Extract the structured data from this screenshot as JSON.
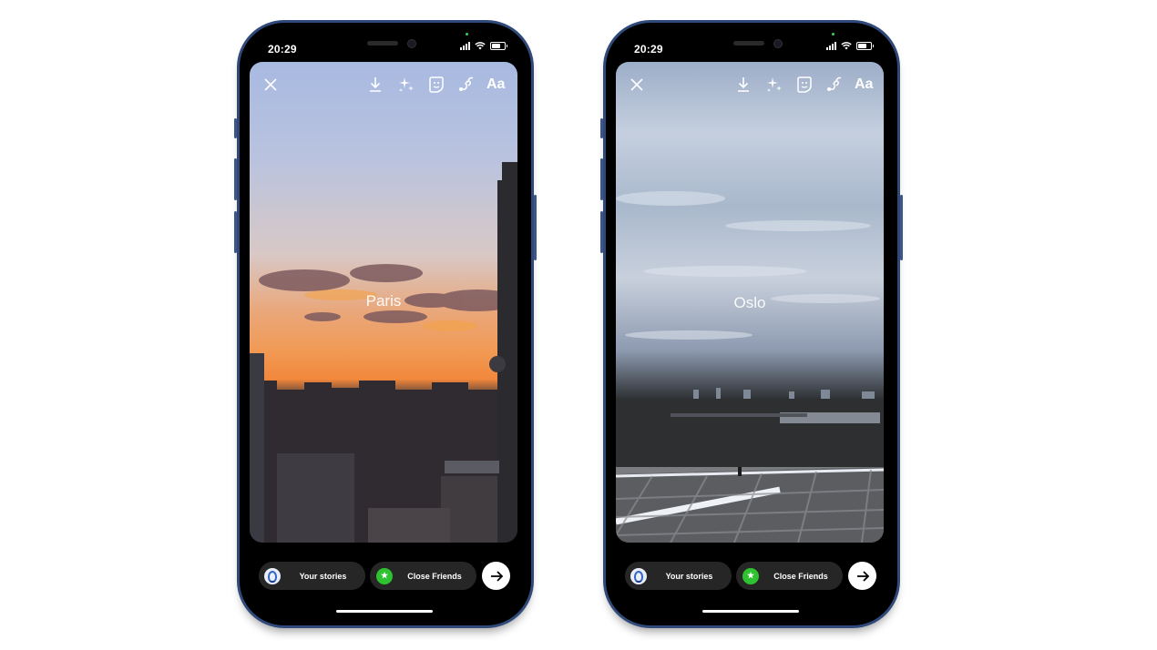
{
  "phones": [
    {
      "status": {
        "time": "20:29"
      },
      "toolbar": {
        "close_icon": "close-icon",
        "download_icon": "download-icon",
        "effects_icon": "sparkles-icon",
        "sticker_icon": "sticker-icon",
        "draw_icon": "draw-icon",
        "text_label": "Aa"
      },
      "story": {
        "caption": "Paris"
      },
      "bottom": {
        "your_stories": "Your stories",
        "close_friends": "Close Friends",
        "close_friends_icon": "★",
        "next_icon": "arrow-right-icon"
      }
    },
    {
      "status": {
        "time": "20:29"
      },
      "toolbar": {
        "close_icon": "close-icon",
        "download_icon": "download-icon",
        "effects_icon": "sparkles-icon",
        "sticker_icon": "sticker-icon",
        "draw_icon": "draw-icon",
        "text_label": "Aa"
      },
      "story": {
        "caption": "Oslo"
      },
      "bottom": {
        "your_stories": "Your stories",
        "close_friends": "Close Friends",
        "close_friends_icon": "★",
        "next_icon": "arrow-right-icon"
      }
    }
  ],
  "colors": {
    "frame": "#2f4a7a",
    "close_friends_green": "#2fc230",
    "pill_bg": "#262626"
  }
}
